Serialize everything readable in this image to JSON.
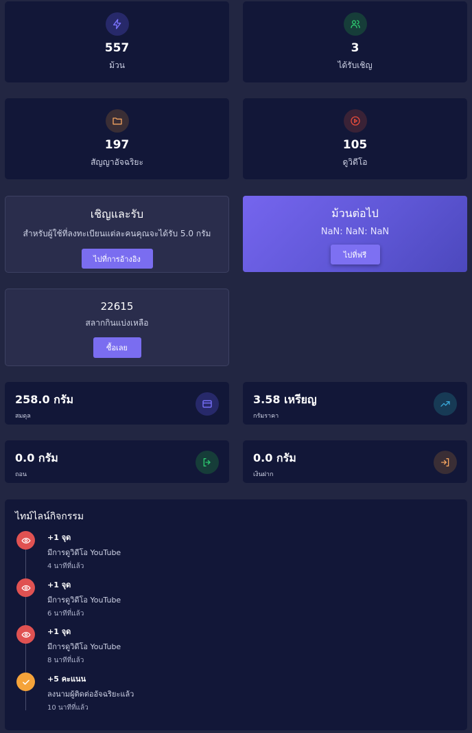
{
  "stats": [
    {
      "value": "557",
      "label": "ม้วน",
      "icon": "lightning-icon",
      "color": "#6c63ff"
    },
    {
      "value": "3",
      "label": "ได้รับเชิญ",
      "icon": "users-icon",
      "color": "#2ecc71"
    },
    {
      "value": "197",
      "label": "สัญญาอัจฉริยะ",
      "icon": "folder-icon",
      "color": "#f4a460"
    },
    {
      "value": "105",
      "label": "ดูวิดีโอ",
      "icon": "play-circle-icon",
      "color": "#e74c3c"
    }
  ],
  "invite": {
    "title": "เชิญและรับ",
    "description": "สำหรับผู้ใช้ที่ลงทะเบียนแต่ละคนคุณจะได้รับ 5.0 กรัม",
    "button": "ไปที่การอ้างอิง"
  },
  "next_roll": {
    "title": "ม้วนต่อไป",
    "countdown": "NaN: NaN: NaN",
    "button": "ไปที่ฟรี"
  },
  "lottery": {
    "value": "22615",
    "label": "สลากกินแบ่งเหลือ",
    "button": "ซื้อเลย"
  },
  "balances": [
    {
      "value": "258.0 กรัม",
      "label": "สมดุล",
      "icon": "credit-card-icon",
      "color": "#6c63ff"
    },
    {
      "value": "3.58 เหรียญ",
      "label": "กรัมราคา",
      "icon": "trending-up-icon",
      "color": "#3aa8d8"
    },
    {
      "value": "0.0 กรัม",
      "label": "ถอน",
      "icon": "logout-icon",
      "color": "#2ecc71"
    },
    {
      "value": "0.0 กรัม",
      "label": "เงินฝาก",
      "icon": "login-icon",
      "color": "#f4a460"
    }
  ],
  "timeline": {
    "title": "ไทม์ไลน์กิจกรรม",
    "items": [
      {
        "points": "+1 จุด",
        "description": "มีการดูวิดีโอ YouTube",
        "time": "4 นาทีที่แล้ว",
        "icon": "eye-icon",
        "color": "#e05252"
      },
      {
        "points": "+1 จุด",
        "description": "มีการดูวิดีโอ YouTube",
        "time": "6 นาทีที่แล้ว",
        "icon": "eye-icon",
        "color": "#e05252"
      },
      {
        "points": "+1 จุด",
        "description": "มีการดูวิดีโอ YouTube",
        "time": "8 นาทีที่แล้ว",
        "icon": "eye-icon",
        "color": "#e05252"
      },
      {
        "points": "+5 คะแนน",
        "description": "ลงนามผู้ติดต่ออัจฉริยะแล้ว",
        "time": "10 นาทีที่แล้ว",
        "icon": "check-icon",
        "color": "#f5a33a"
      }
    ]
  }
}
